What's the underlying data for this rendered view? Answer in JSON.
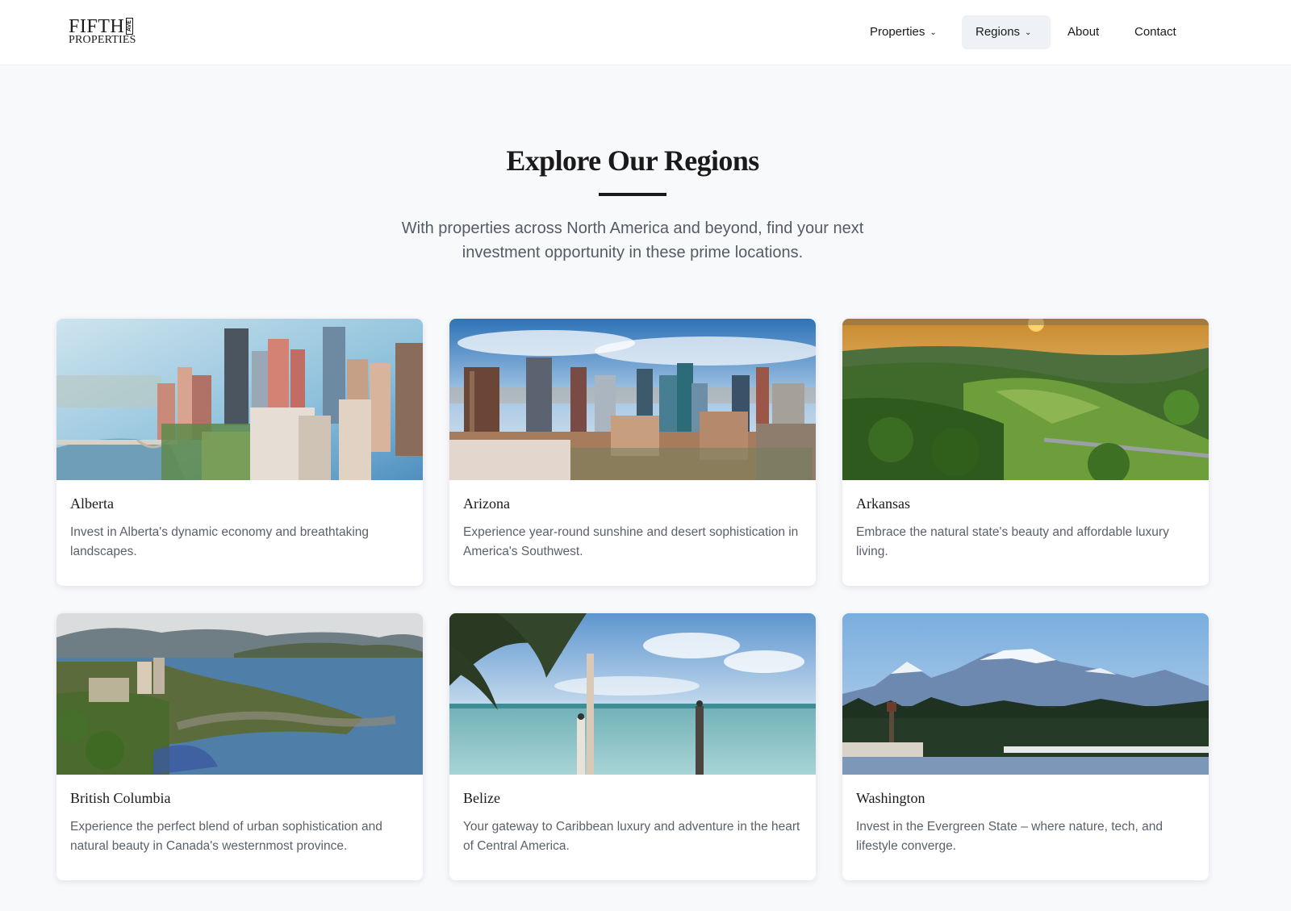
{
  "brand": {
    "line1": "FIFTH",
    "ave": "AVE",
    "line2": "PROPERTIES"
  },
  "nav": {
    "items": [
      {
        "label": "Properties",
        "has_dropdown": true,
        "active": false
      },
      {
        "label": "Regions",
        "has_dropdown": true,
        "active": true
      },
      {
        "label": "About",
        "has_dropdown": false,
        "active": false
      },
      {
        "label": "Contact",
        "has_dropdown": false,
        "active": false
      }
    ],
    "dropdown_icon": "chevron-down-icon"
  },
  "section": {
    "title": "Explore Our Regions",
    "subtitle": "With properties across North America and beyond, find your next investment opportunity in these prime locations."
  },
  "regions": [
    {
      "name": "Alberta",
      "description": "Invest in Alberta's dynamic economy and breathtaking landscapes.",
      "image": "city-skyline-river-photo"
    },
    {
      "name": "Arizona",
      "description": "Experience year-round sunshine and desert sophistication in America's Southwest.",
      "image": "desert-city-skyline-photo"
    },
    {
      "name": "Arkansas",
      "description": "Embrace the natural state's beauty and affordable luxury living.",
      "image": "forested-hills-sunset-photo"
    },
    {
      "name": "British Columbia",
      "description": "Experience the perfect blend of urban sophistication and natural beauty in Canada's westernmost province.",
      "image": "lake-town-mountains-photo"
    },
    {
      "name": "Belize",
      "description": "Your gateway to Caribbean luxury and adventure in the heart of Central America.",
      "image": "tropical-beach-palm-photo"
    },
    {
      "name": "Washington",
      "description": "Invest in the Evergreen State – where nature, tech, and lifestyle converge.",
      "image": "snowy-mountains-harbor-photo"
    }
  ],
  "colors": {
    "page_bg": "#f8f9fb",
    "header_bg": "#ffffff",
    "active_nav_bg": "#eef1f5",
    "text": "#1a1a1a",
    "muted_text": "#5b616a"
  }
}
